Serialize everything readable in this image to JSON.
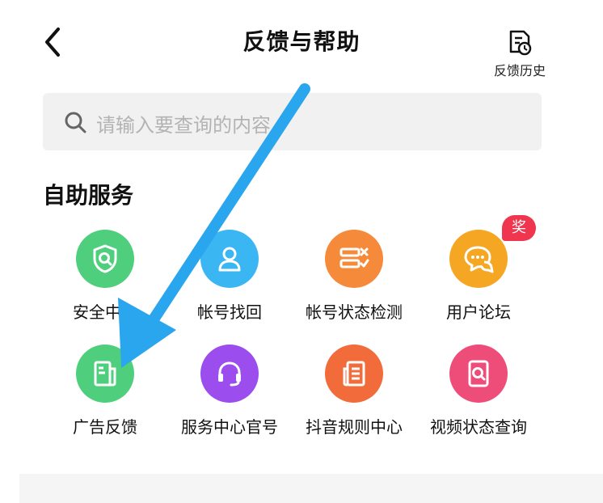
{
  "header": {
    "title": "反馈与帮助",
    "history_label": "反馈历史"
  },
  "search": {
    "placeholder": "请输入要查询的内容"
  },
  "section": {
    "title": "自助服务"
  },
  "services": [
    {
      "label": "安全中心",
      "icon": "shield-search-icon",
      "color": "#4fcf7d"
    },
    {
      "label": "帐号找回",
      "icon": "user-icon",
      "color": "#3ab6f2"
    },
    {
      "label": "帐号状态检测",
      "icon": "checklist-icon",
      "color": "#f58a3b"
    },
    {
      "label": "用户论坛",
      "icon": "chat-bubbles-icon",
      "color": "#f5a623",
      "badge": "奖"
    },
    {
      "label": "广告反馈",
      "icon": "document-icon",
      "color": "#4fcf7d"
    },
    {
      "label": "服务中心官号",
      "icon": "headset-icon",
      "color": "#9b4dee"
    },
    {
      "label": "抖音规则中心",
      "icon": "rules-book-icon",
      "color": "#f26b3a"
    },
    {
      "label": "视频状态查询",
      "icon": "video-search-icon",
      "color": "#ee4d7a"
    }
  ],
  "colors": {
    "annotation_arrow": "#2aa6ee"
  }
}
